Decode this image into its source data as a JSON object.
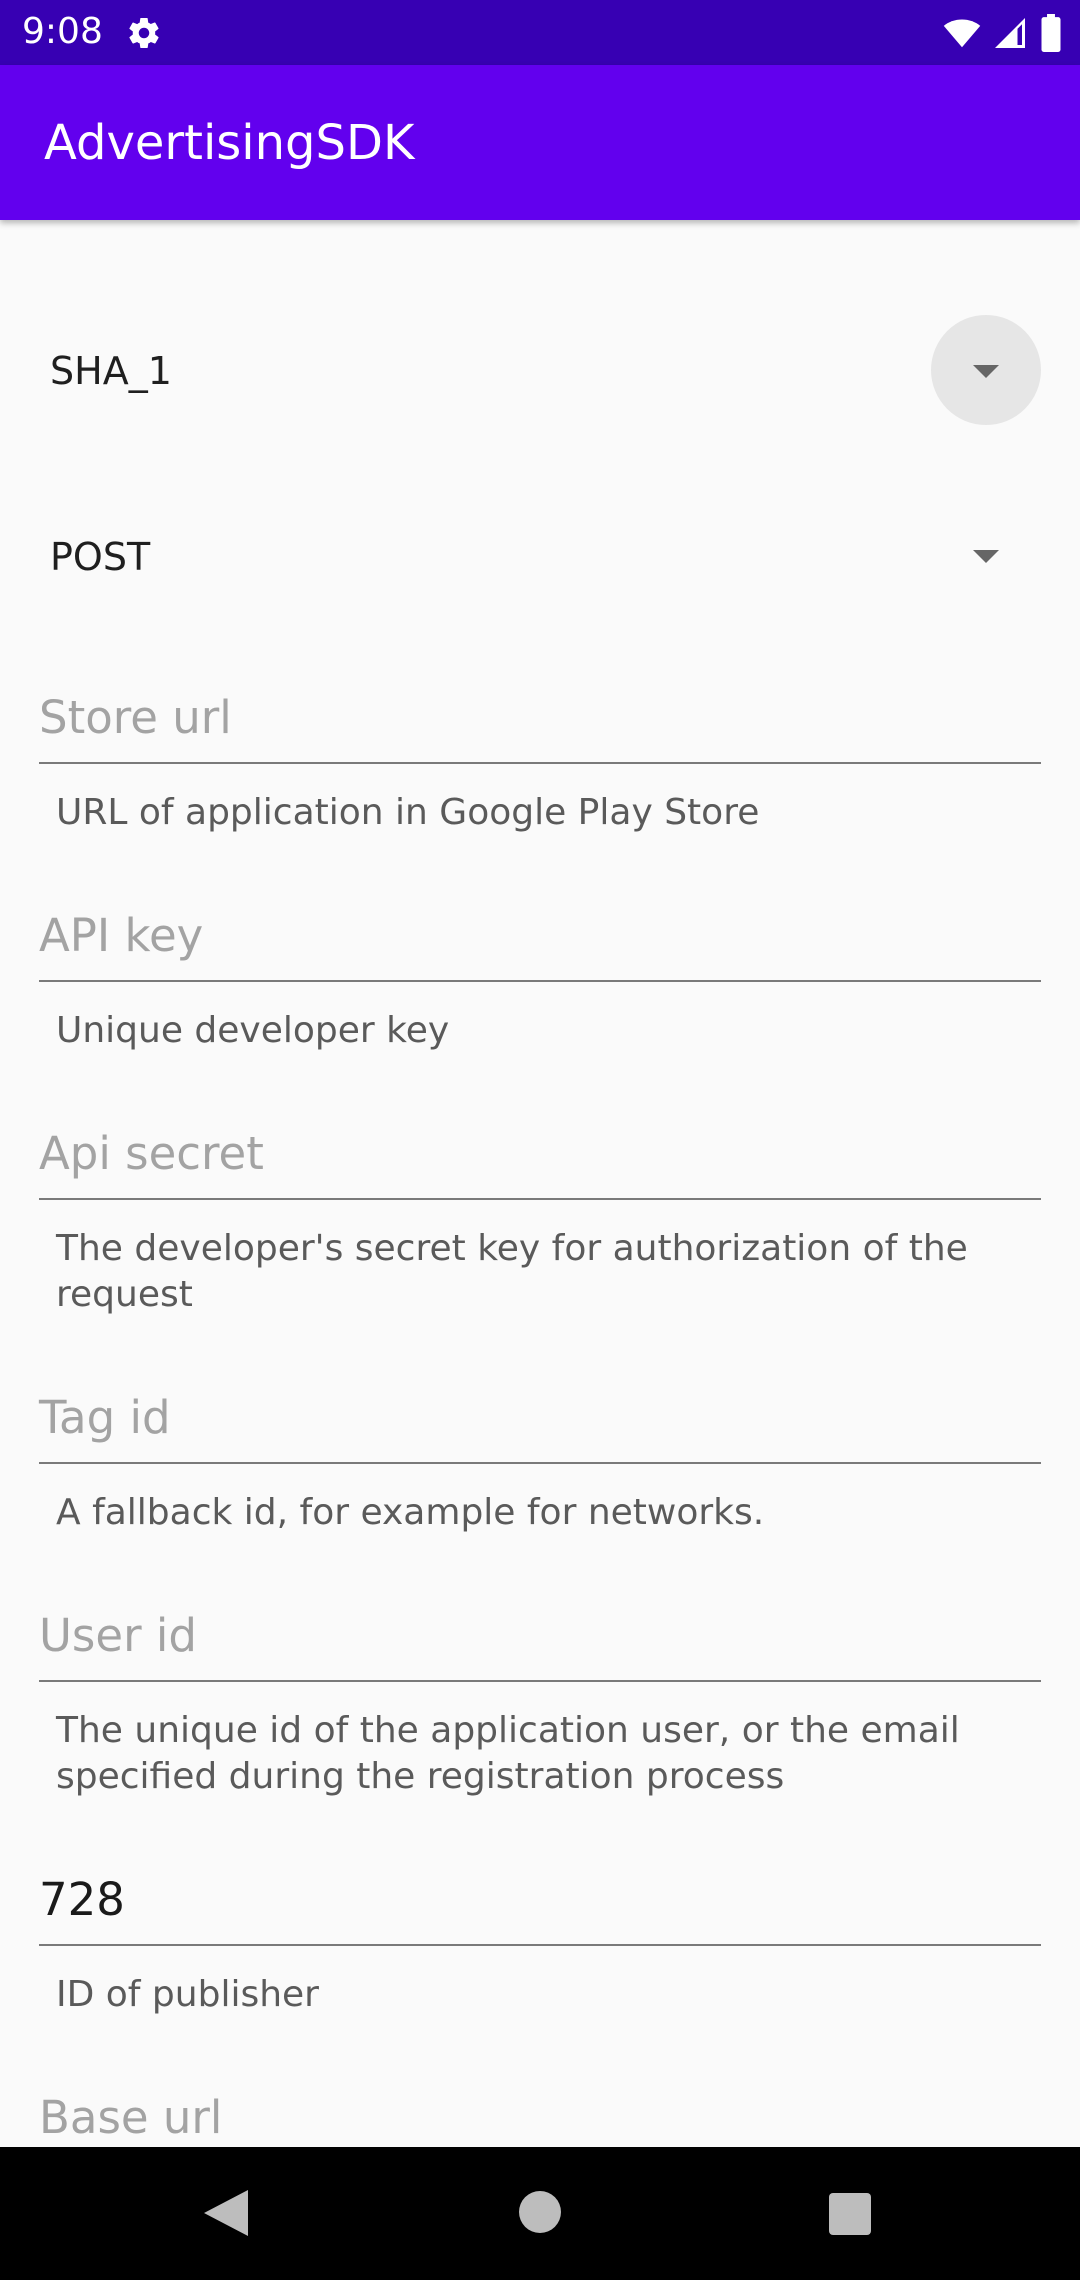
{
  "status_bar": {
    "time": "9:08",
    "icons": [
      "gear-icon",
      "wifi-icon",
      "signal-icon",
      "battery-icon"
    ]
  },
  "app_bar": {
    "title": "AdvertisingSDK"
  },
  "spinners": {
    "hash": {
      "value": "SHA_1"
    },
    "method": {
      "value": "POST"
    }
  },
  "fields": {
    "store_url": {
      "placeholder": "Store url",
      "value": "",
      "hint": "URL of application in Google Play Store"
    },
    "api_key": {
      "placeholder": "API key",
      "value": "",
      "hint": "Unique developer key"
    },
    "api_secret": {
      "placeholder": "Api secret",
      "value": "",
      "hint": "The developer's secret key for authorization of the request"
    },
    "tag_id": {
      "placeholder": "Tag id",
      "value": "",
      "hint": "A fallback id, for example for networks."
    },
    "user_id": {
      "placeholder": "User id",
      "value": "",
      "hint": "The unique id of the application user, or the email specified during the registration process"
    },
    "publisher_id": {
      "placeholder": "",
      "value": "728",
      "hint": "ID of publisher"
    },
    "base_url": {
      "placeholder": "Base url",
      "value": ""
    }
  },
  "nav_bar": {
    "icons": [
      "back-icon",
      "home-icon",
      "recents-icon"
    ]
  },
  "colors": {
    "status_bar": "#3700b3",
    "app_bar": "#6200ee",
    "background": "#fafafa",
    "hint_text": "#a3a3a3",
    "helper_text": "#5a5a5a",
    "underline": "#7a7a7a"
  }
}
